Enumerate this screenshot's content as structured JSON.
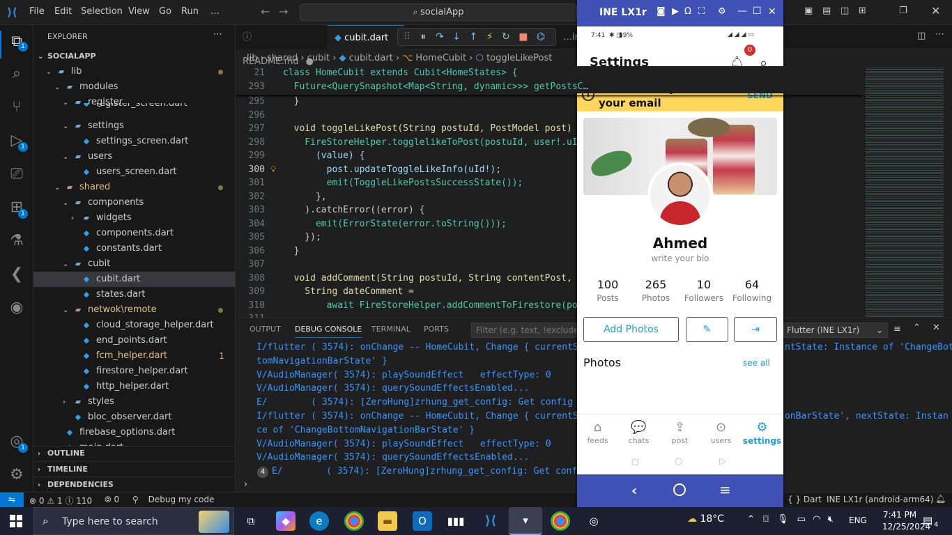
{
  "titlebar": {
    "menu": [
      "File",
      "Edit",
      "Selection",
      "View",
      "Go",
      "Run",
      "…"
    ],
    "search": "socialApp"
  },
  "activity_badges": [
    "1",
    "1",
    "1",
    "1"
  ],
  "explorer": {
    "title": "EXPLORER",
    "project": "SOCIALAPP",
    "items": [
      {
        "label": "lib",
        "indent": 1,
        "type": "folder-open",
        "dot": true
      },
      {
        "label": "modules",
        "indent": 2,
        "type": "folder-open"
      },
      {
        "label": "register",
        "indent": 3,
        "type": "folder-open"
      },
      {
        "label": "register_screen.dart",
        "indent": 4,
        "type": "dart"
      },
      {
        "label": "settings",
        "indent": 3,
        "type": "folder-open"
      },
      {
        "label": "settings_screen.dart",
        "indent": 4,
        "type": "dart"
      },
      {
        "label": "users",
        "indent": 3,
        "type": "folder-open"
      },
      {
        "label": "users_screen.dart",
        "indent": 4,
        "type": "dart"
      },
      {
        "label": "shared",
        "indent": 2,
        "type": "folder-open",
        "color": "orange",
        "dot": true
      },
      {
        "label": "components",
        "indent": 3,
        "type": "folder-open"
      },
      {
        "label": "widgets",
        "indent": 4,
        "type": "folder"
      },
      {
        "label": "components.dart",
        "indent": 4,
        "type": "dart"
      },
      {
        "label": "constants.dart",
        "indent": 4,
        "type": "dart"
      },
      {
        "label": "cubit",
        "indent": 3,
        "type": "folder-open"
      },
      {
        "label": "cubit.dart",
        "indent": 4,
        "type": "dart",
        "selected": true
      },
      {
        "label": "states.dart",
        "indent": 4,
        "type": "dart"
      },
      {
        "label": "netwok\\remote",
        "indent": 3,
        "type": "folder-open",
        "color": "orange",
        "dot": true
      },
      {
        "label": "cloud_storage_helper.dart",
        "indent": 4,
        "type": "dart"
      },
      {
        "label": "end_points.dart",
        "indent": 4,
        "type": "dart"
      },
      {
        "label": "fcm_helper.dart",
        "indent": 4,
        "type": "dart",
        "color": "orange",
        "badge": "1"
      },
      {
        "label": "firestore_helper.dart",
        "indent": 4,
        "type": "dart"
      },
      {
        "label": "http_helper.dart",
        "indent": 4,
        "type": "dart"
      },
      {
        "label": "styles",
        "indent": 3,
        "type": "folder"
      },
      {
        "label": "bloc_observer.dart",
        "indent": 3,
        "type": "dart"
      },
      {
        "label": "firebase_options.dart",
        "indent": 2,
        "type": "dart"
      },
      {
        "label": "main.dart",
        "indent": 2,
        "type": "dart"
      }
    ],
    "sections": [
      "OUTLINE",
      "TIMELINE",
      "DEPENDENCIES"
    ]
  },
  "editor": {
    "tabs": [
      {
        "label": "README.md",
        "active": false
      },
      {
        "label": "cubit.dart",
        "active": true
      },
      {
        "label": "…ings_…",
        "active": false
      }
    ],
    "breadcrumb": [
      "lib",
      "shared",
      "cubit",
      "cubit.dart",
      "HomeCubit",
      "toggleLikePost"
    ],
    "sticky": [
      {
        "ln": "21",
        "code": "class HomeCubit extends Cubit<HomeStates> {"
      },
      {
        "ln": "293",
        "code": "  Future<QuerySnapshot<Map<String, dynamic>>> getPostsC…"
      }
    ],
    "lines": [
      {
        "ln": "295",
        "code": "  }"
      },
      {
        "ln": "296",
        "code": ""
      },
      {
        "ln": "297",
        "code": "  void toggleLikePost(String postuId, PostModel post) {"
      },
      {
        "ln": "298",
        "code": "    FireStoreHelper.togglelikeToPost(postuId, user!.uId"
      },
      {
        "ln": "299",
        "code": "      (value) {"
      },
      {
        "ln": "300",
        "code": "        post.updateToggleLikeInfo(uId!);"
      },
      {
        "ln": "301",
        "code": "        emit(ToggleLikePostsSuccessState());"
      },
      {
        "ln": "302",
        "code": "      },"
      },
      {
        "ln": "303",
        "code": "    ).catchError((error) {"
      },
      {
        "ln": "304",
        "code": "      emit(ErrorState(error.toString()));"
      },
      {
        "ln": "305",
        "code": "    });"
      },
      {
        "ln": "306",
        "code": "  }"
      },
      {
        "ln": "307",
        "code": ""
      },
      {
        "ln": "308",
        "code": "  void addComment(String postuId, String contentPost, P"
      },
      {
        "ln": "309",
        "code": "    String dateComment ="
      },
      {
        "ln": "310",
        "code": "        await FireStoreHelper.addCommentToFirestore(pos"
      },
      {
        "ln": "311",
        "code": ""
      }
    ]
  },
  "panel": {
    "tabs": [
      "OUTPUT",
      "DEBUG CONSOLE",
      "TERMINAL",
      "PORTS"
    ],
    "filter_placeholder": "Filter (e.g. text, !exclude, \\esc",
    "device_select": "Flutter (INE LX1r)",
    "log": [
      "I/flutter ( 3574): onChange -- HomeCubit, Change { currentSt",
      "tomNavigationBarState' }",
      "V/AudioManager( 3574): playSoundEffect   effectType: 0",
      "V/AudioManager( 3574): querySoundEffectsEnabled...",
      "E/        ( 3574): [ZeroHung]zrhung_get_config: Get config f",
      "I/flutter ( 3574): onChange -- HomeCubit, Change { currentSt",
      "ce of 'ChangeBottomNavigationBarState' }",
      "V/AudioManager( 3574): playSoundEffect   effectType: 0",
      "V/AudioManager( 3574): querySoundEffectsEnabled...",
      "E/        ( 3574): [ZeroHung]zrhung_get_config: Get confi"
    ],
    "log_right": [
      "ntState: Instance of 'ChangeBot",
      "onBarState', nextState: Instan"
    ],
    "repeat_badge": "4"
  },
  "statusbar": {
    "errors": "0",
    "warnings": "1",
    "infos": "110",
    "ports": "0",
    "debug": "Debug my code",
    "lang": "Dart",
    "device": "INE LX1r (android-arm64)"
  },
  "phone": {
    "window_title": "INE LX1r",
    "status_time": "7:41",
    "status_battery": "59%",
    "app_title": "Settings",
    "notif_count": "0",
    "verify_text": "Please Verify your email",
    "verify_action": "SEND",
    "name": "Ahmed",
    "bio": "write your bio",
    "stats": [
      {
        "num": "100",
        "label": "Posts"
      },
      {
        "num": "265",
        "label": "Photos"
      },
      {
        "num": "10",
        "label": "Followers"
      },
      {
        "num": "64",
        "label": "Following"
      }
    ],
    "add_photos": "Add Photos",
    "photos_heading": "Photos",
    "see_all": "see all",
    "nav": [
      {
        "label": "feeds",
        "icon": "⌂"
      },
      {
        "label": "chats",
        "icon": "💬"
      },
      {
        "label": "post",
        "icon": "⇪"
      },
      {
        "label": "users",
        "icon": "⊙"
      },
      {
        "label": "settings",
        "icon": "⚙"
      }
    ]
  },
  "taskbar": {
    "search_placeholder": "Type here to search",
    "weather": "18°C",
    "lang": "ENG",
    "time": "7:41 PM",
    "date": "12/25/2024",
    "notifications": "4"
  }
}
